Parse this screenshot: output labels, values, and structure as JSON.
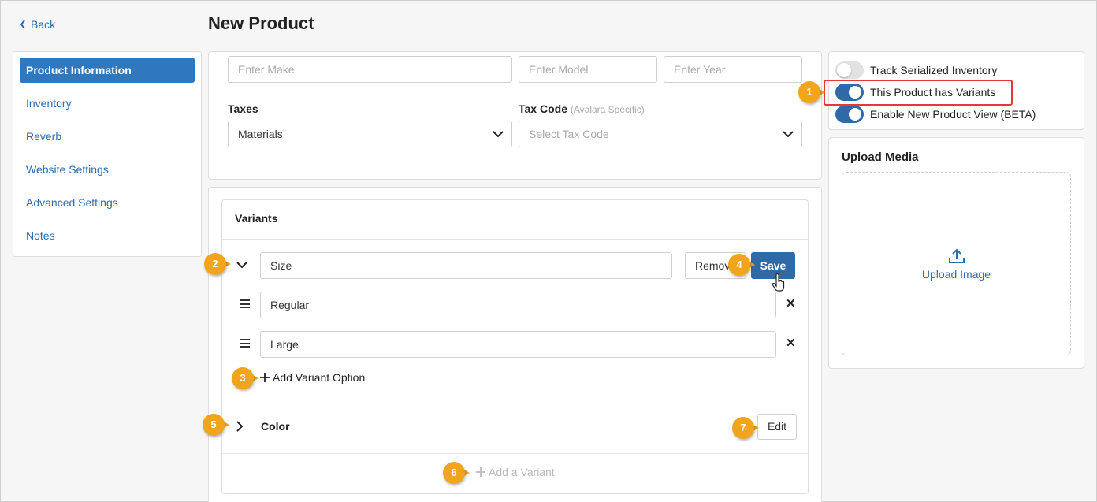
{
  "header": {
    "back_label": "Back",
    "title": "New Product"
  },
  "sidebar": {
    "items": [
      {
        "label": "Product Information",
        "active": true
      },
      {
        "label": "Inventory"
      },
      {
        "label": "Reverb"
      },
      {
        "label": "Website Settings"
      },
      {
        "label": "Advanced Settings"
      },
      {
        "label": "Notes"
      }
    ]
  },
  "product_fields": {
    "make_placeholder": "Enter Make",
    "model_placeholder": "Enter Model",
    "year_placeholder": "Enter Year",
    "taxes_label": "Taxes",
    "taxes_value": "Materials",
    "tax_code_label": "Tax Code",
    "tax_code_hint": "(Avalara Specific)",
    "tax_code_placeholder": "Select Tax Code"
  },
  "variants": {
    "title": "Variants",
    "expanded_variant": {
      "name": "Size",
      "remove_label": "Remove",
      "save_label": "Save",
      "options": [
        "Regular",
        "Large"
      ]
    },
    "add_option_label": "Add Variant Option",
    "collapsed_variant": {
      "name": "Color",
      "edit_label": "Edit"
    },
    "add_variant_label": "Add a Variant"
  },
  "toggles": [
    {
      "label": "Track Serialized Inventory",
      "on": false
    },
    {
      "label": "This Product has Variants",
      "on": true
    },
    {
      "label": "Enable New Product View (BETA)",
      "on": true
    }
  ],
  "upload": {
    "title": "Upload Media",
    "button_label": "Upload Image"
  },
  "callouts": [
    "1",
    "2",
    "3",
    "4",
    "5",
    "6",
    "7"
  ],
  "colors": {
    "accent": "#2f6aa6",
    "link": "#2a6db3",
    "callout": "#f2a51a",
    "highlight": "#e53935"
  }
}
